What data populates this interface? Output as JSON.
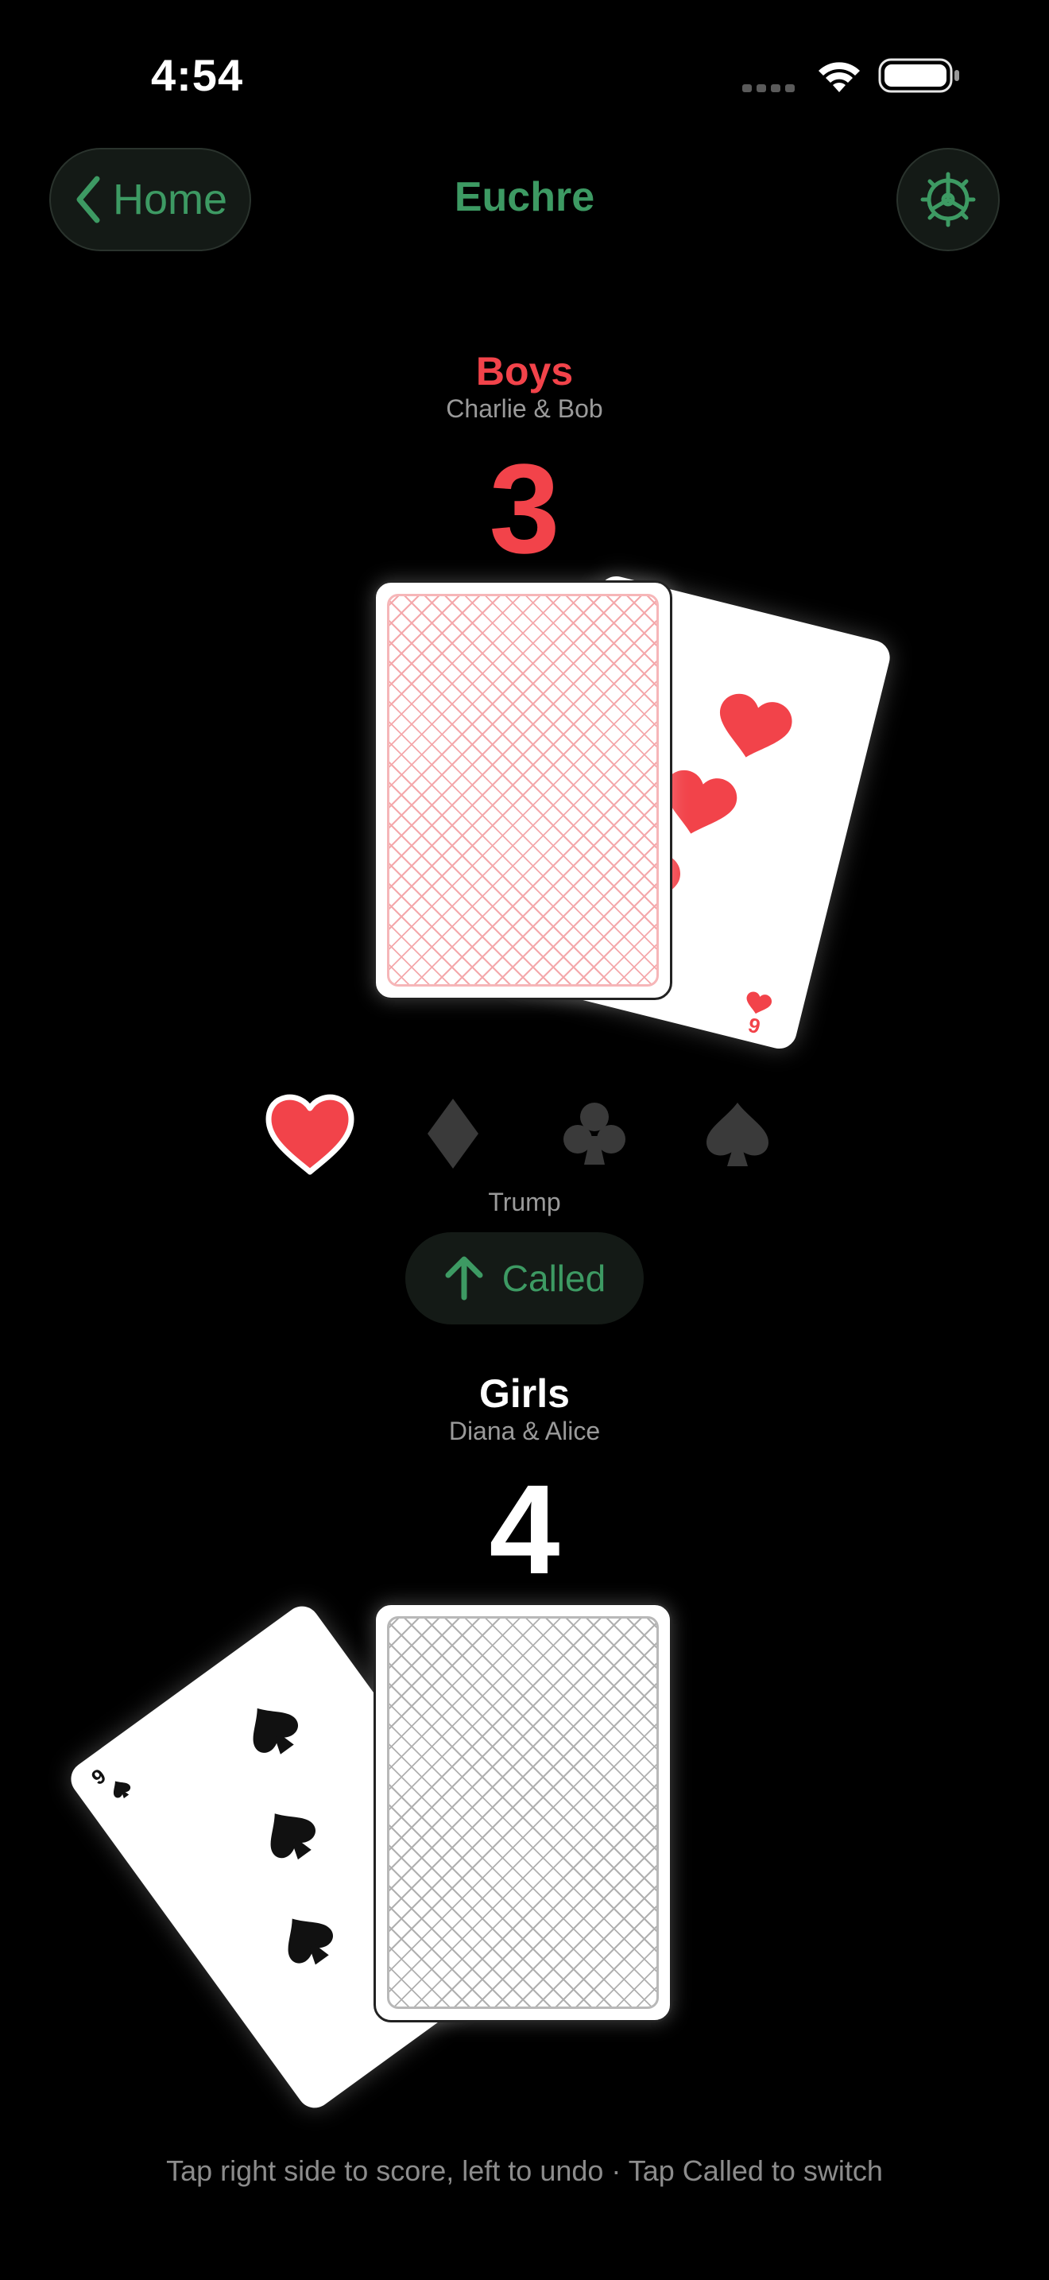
{
  "status_bar": {
    "time": "4:54"
  },
  "nav": {
    "back_label": "Home",
    "title": "Euchre"
  },
  "teams": [
    {
      "name": "Boys",
      "players": "Charlie & Bob",
      "score": "3",
      "color": "#f2434a",
      "revealed_card": "9",
      "revealed_suit": "hearts"
    },
    {
      "name": "Girls",
      "players": "Diana & Alice",
      "score": "4",
      "color": "#ffffff",
      "revealed_card": "9",
      "revealed_suit": "spades"
    }
  ],
  "trump": {
    "label": "Trump",
    "suits": [
      "hearts",
      "diamonds",
      "clubs",
      "spades"
    ],
    "selected": "hearts"
  },
  "called": {
    "label": "Called",
    "icon": "arrow-up-icon"
  },
  "hint": "Tap right side to score, left to undo · Tap Called to switch",
  "colors": {
    "accent": "#3d9a63",
    "red": "#f2434a",
    "inactive_suit": "#3a3a3a"
  }
}
